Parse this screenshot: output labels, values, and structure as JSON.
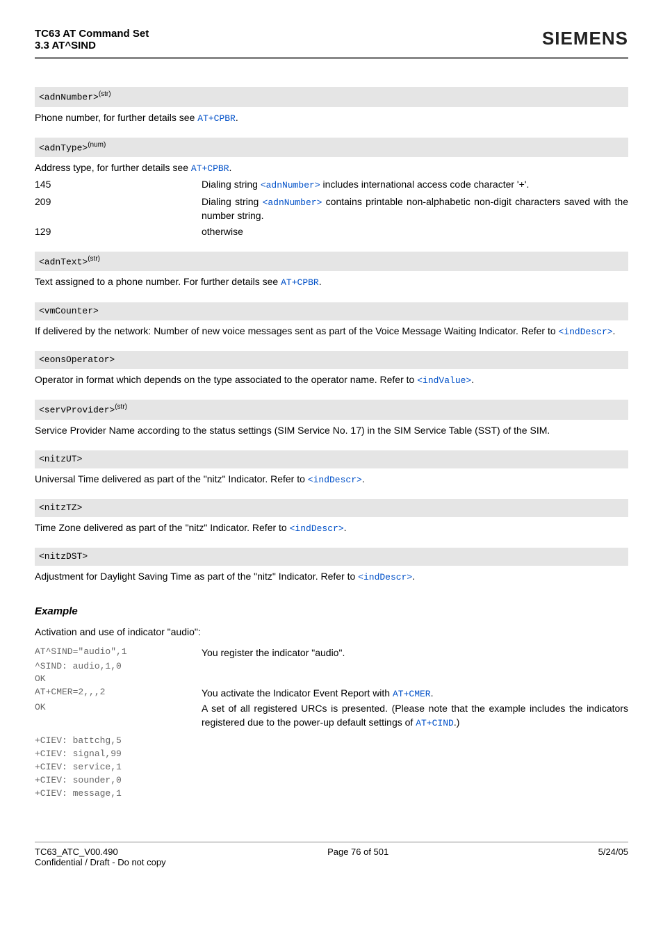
{
  "header": {
    "title": "TC63 AT Command Set",
    "subtitle": "3.3 AT^SIND",
    "brand": "SIEMENS"
  },
  "params": {
    "adnNumber": {
      "name": "<adnNumber>",
      "sup": "(str)",
      "desc_pre": "Phone number, for further details see ",
      "desc_link": "AT+CPBR",
      "desc_post": "."
    },
    "adnType": {
      "name": "<adnType>",
      "sup": "(num)",
      "desc_pre": "Address type, for further details see ",
      "desc_link": "AT+CPBR",
      "desc_post": ".",
      "rows": [
        {
          "key": "145",
          "pre": "Dialing string ",
          "link": "<adnNumber>",
          "post": " includes international access code character '+'."
        },
        {
          "key": "209",
          "pre": "Dialing string ",
          "link": "<adnNumber>",
          "post": " contains printable non-alphabetic non-digit characters saved with the number string."
        },
        {
          "key": "129",
          "pre": "",
          "link": "",
          "post": "otherwise"
        }
      ]
    },
    "adnText": {
      "name": "<adnText>",
      "sup": "(str)",
      "desc_pre": "Text assigned to a phone number. For further details see ",
      "desc_link": "AT+CPBR",
      "desc_post": "."
    },
    "vmCounter": {
      "name": "<vmCounter>",
      "desc_pre": "If delivered by the network: Number of new voice messages sent as part of the Voice Message Waiting Indicator. Refer to ",
      "desc_link": "<indDescr>",
      "desc_post": "."
    },
    "eonsOperator": {
      "name": "<eonsOperator>",
      "desc_pre": "Operator in format which depends on the type associated to the operator name. Refer to ",
      "desc_link": "<indValue>",
      "desc_post": "."
    },
    "servProvider": {
      "name": "<servProvider>",
      "sup": "(str)",
      "desc": "Service Provider Name according to the status settings (SIM Service No. 17) in the SIM Service Table (SST) of the SIM."
    },
    "nitzUT": {
      "name": "<nitzUT>",
      "desc_pre": "Universal Time delivered as part of the \"nitz\" Indicator. Refer to ",
      "desc_link": "<indDescr>",
      "desc_post": "."
    },
    "nitzTZ": {
      "name": "<nitzTZ>",
      "desc_pre": "Time Zone delivered as part of the \"nitz\" Indicator. Refer to ",
      "desc_link": "<indDescr>",
      "desc_post": "."
    },
    "nitzDST": {
      "name": "<nitzDST>",
      "desc_pre": "Adjustment for Daylight Saving Time as part of the \"nitz\" Indicator. Refer to ",
      "desc_link": "<indDescr>",
      "desc_post": "."
    }
  },
  "example": {
    "heading": "Example",
    "intro": "Activation and use of indicator \"audio\":",
    "rows": [
      {
        "left": "AT^SIND=\"audio\",1",
        "right_pre": "You register the indicator \"audio\".",
        "right_link": "",
        "right_post": ""
      },
      {
        "left": "^SIND: audio,1,0",
        "right_pre": "",
        "right_link": "",
        "right_post": ""
      },
      {
        "left": "OK",
        "right_pre": "",
        "right_link": "",
        "right_post": ""
      },
      {
        "left": "AT+CMER=2,,,2",
        "right_pre": "You activate the Indicator Event Report with ",
        "right_link": "AT+CMER",
        "right_post": "."
      },
      {
        "left": "OK",
        "right_pre": "A set of all registered URCs is presented. (Please note that the example includes the indicators registered due to the power-up default settings of ",
        "right_link": "AT+CIND",
        "right_post": ".)"
      },
      {
        "left": "+CIEV: battchg,5",
        "right_pre": "",
        "right_link": "",
        "right_post": ""
      },
      {
        "left": "+CIEV: signal,99",
        "right_pre": "",
        "right_link": "",
        "right_post": ""
      },
      {
        "left": "+CIEV: service,1",
        "right_pre": "",
        "right_link": "",
        "right_post": ""
      },
      {
        "left": "+CIEV: sounder,0",
        "right_pre": "",
        "right_link": "",
        "right_post": ""
      },
      {
        "left": "+CIEV: message,1",
        "right_pre": "",
        "right_link": "",
        "right_post": ""
      }
    ]
  },
  "footer": {
    "left": "TC63_ATC_V00.490",
    "center": "Page 76 of 501",
    "right": "5/24/05",
    "sub": "Confidential / Draft - Do not copy"
  }
}
